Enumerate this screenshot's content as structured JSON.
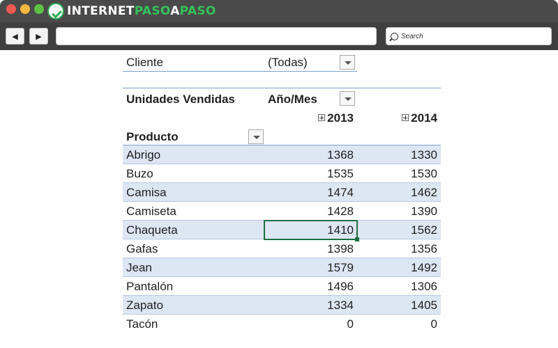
{
  "browser": {
    "logo": {
      "part1": "INTERNET",
      "part2": "PASO",
      "part3": "A",
      "part4": "PASO"
    },
    "nav": {
      "back_glyph": "◀",
      "forward_glyph": "▶"
    },
    "search": {
      "placeholder": "Search",
      "icon": "search-icon"
    },
    "colors": {
      "close": "#ee5a52",
      "minimize": "#f4b740",
      "maximize": "#5ec146",
      "brand_green": "#35c15a"
    }
  },
  "pivot": {
    "filter": {
      "label": "Cliente",
      "value": "(Todas)"
    },
    "values_label": "Unidades Vendidas",
    "columns_label": "Año/Mes",
    "column_headers": [
      "2013",
      "2014"
    ],
    "rows_label": "Producto",
    "rows": [
      {
        "product": "Abrigo",
        "y2013": "1368",
        "y2014": "1330"
      },
      {
        "product": "Buzo",
        "y2013": "1535",
        "y2014": "1530"
      },
      {
        "product": "Camisa",
        "y2013": "1474",
        "y2014": "1462"
      },
      {
        "product": "Camiseta",
        "y2013": "1428",
        "y2014": "1390"
      },
      {
        "product": "Chaqueta",
        "y2013": "1410",
        "y2014": "1562"
      },
      {
        "product": "Gafas",
        "y2013": "1398",
        "y2014": "1356"
      },
      {
        "product": "Jean",
        "y2013": "1579",
        "y2014": "1492"
      },
      {
        "product": "Pantalón",
        "y2013": "1496",
        "y2014": "1306"
      },
      {
        "product": "Zapato",
        "y2013": "1334",
        "y2014": "1405"
      },
      {
        "product": "Tacón",
        "y2013": "0",
        "y2014": "0"
      }
    ],
    "colors": {
      "band": "#dde6f3",
      "selection": "#1e6e40",
      "header_border": "#7f9fcf"
    }
  }
}
